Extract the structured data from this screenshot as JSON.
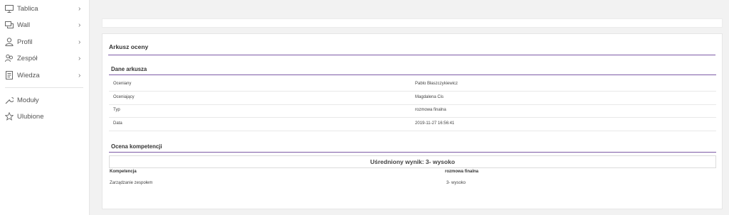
{
  "sidebar": {
    "items": [
      {
        "label": "Tablica",
        "icon": "monitor-icon",
        "chevron": "›"
      },
      {
        "label": "Wall",
        "icon": "chat-icon",
        "chevron": "›"
      },
      {
        "label": "Profil",
        "icon": "user-icon",
        "chevron": "›"
      },
      {
        "label": "Zespół",
        "icon": "team-icon",
        "chevron": "›"
      },
      {
        "label": "Wiedza",
        "icon": "document-icon",
        "chevron": "›"
      },
      {
        "label": "Moduły",
        "icon": "wrench-icon"
      },
      {
        "label": "Ulubione",
        "icon": "star-icon"
      }
    ]
  },
  "card": {
    "title": "Arkusz oceny",
    "data_section": {
      "title": "Dane arkusza",
      "rows": [
        {
          "key": "Oceniany",
          "value": "Pablo Błaszczykiewicz"
        },
        {
          "key": "Oceniający",
          "value": "Magdalena Cis"
        },
        {
          "key": "Typ",
          "value": "rozmowa finalna"
        },
        {
          "key": "Data",
          "value": "2019-11-27 16:56:41"
        }
      ]
    },
    "competence_section": {
      "title": "Ocena kompetencji",
      "average": "Uśredniony wynik: 3- wysoko",
      "columns": [
        "Kompetencja",
        "rozmowa finalna"
      ],
      "rows": [
        {
          "name": "Zarządzanie zespołem",
          "score": "3- wysoko"
        }
      ]
    }
  },
  "colors": {
    "accent_line": "#7c5aa6",
    "sidebar_bg": "#ffffff",
    "page_bg": "#f2f2f2"
  }
}
